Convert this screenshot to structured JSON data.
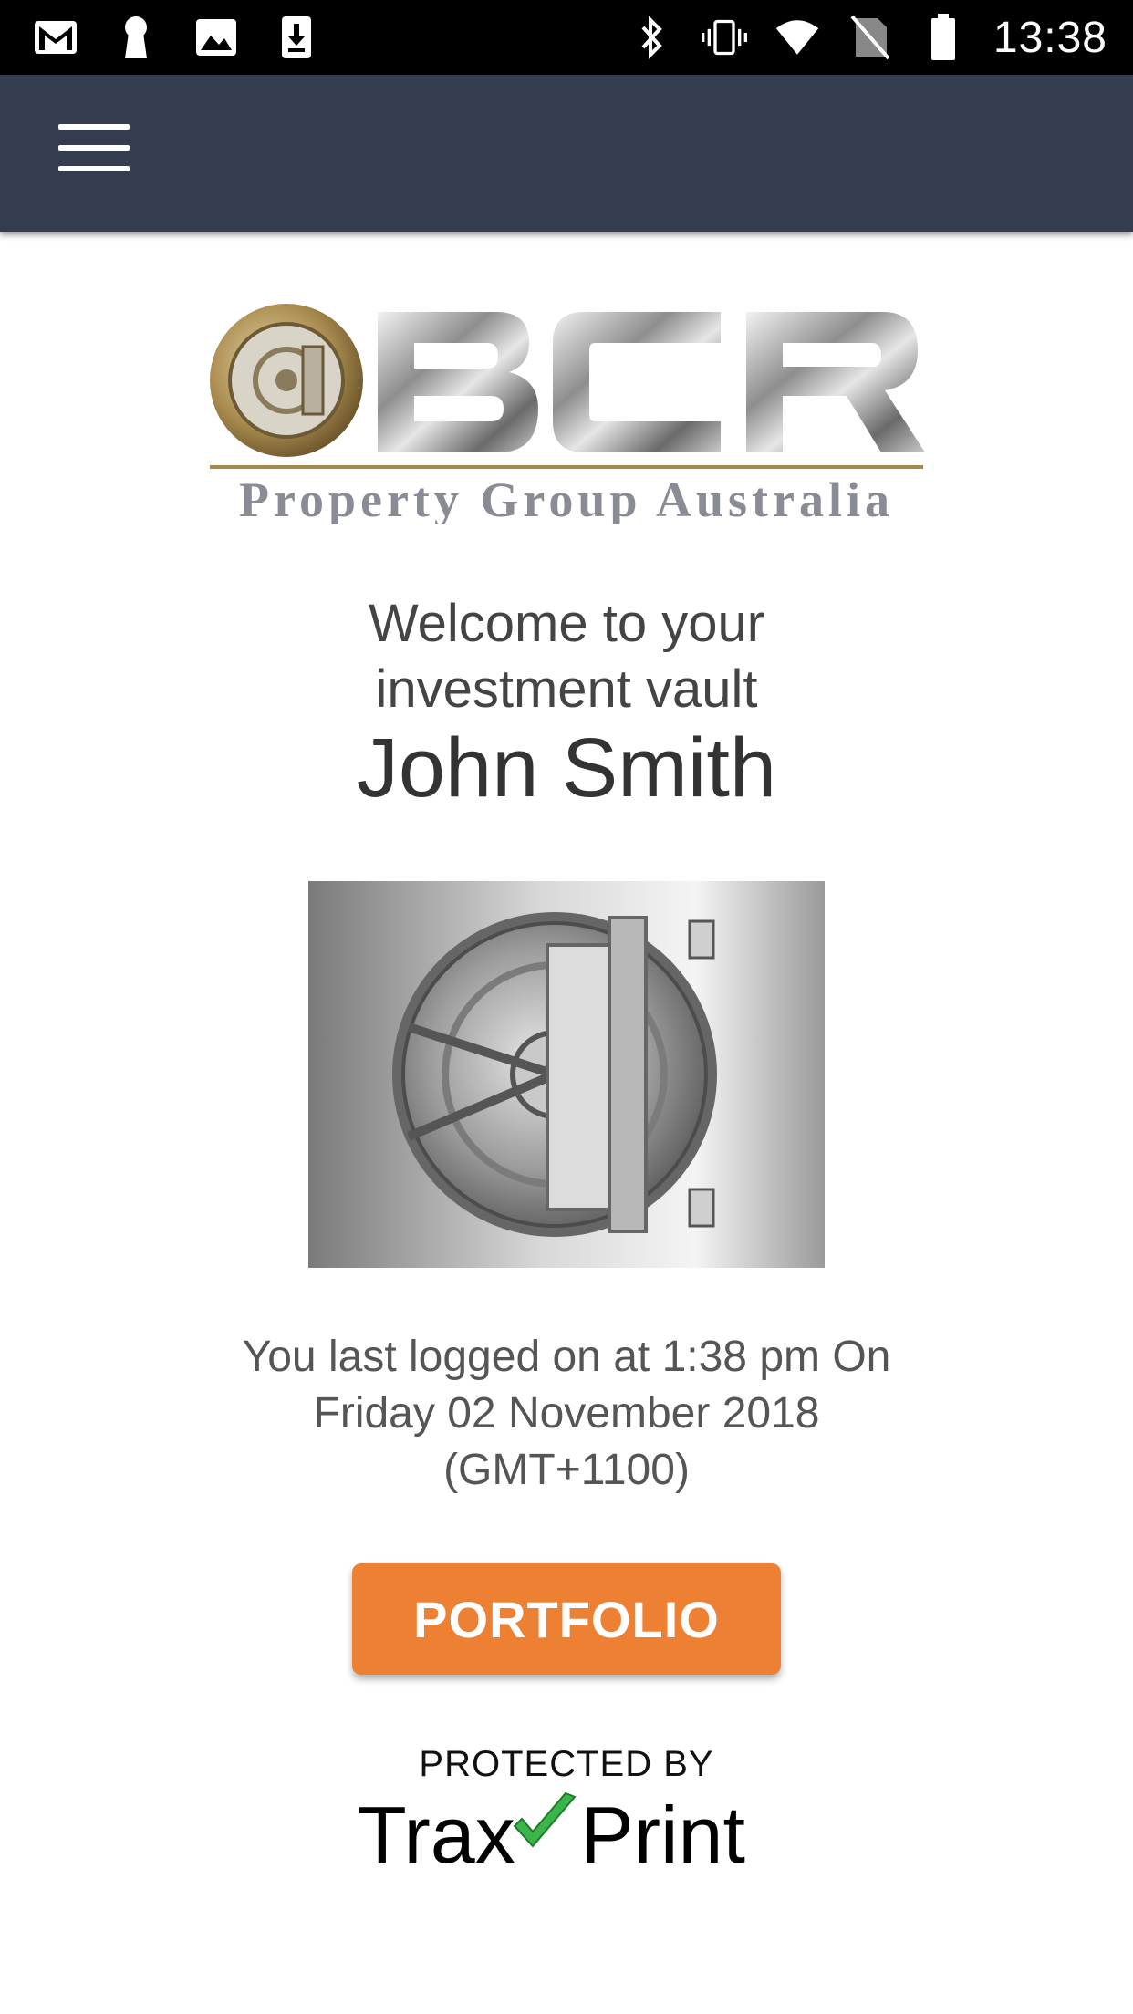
{
  "status_bar": {
    "time": "13:38",
    "left_icons": [
      "gmail-icon",
      "keyhole-icon",
      "image-icon",
      "download-icon"
    ],
    "right_icons": [
      "bluetooth-icon",
      "vibrate-icon",
      "wifi-icon",
      "no-sim-icon",
      "battery-icon"
    ]
  },
  "app_bar": {
    "background": "#343d50",
    "menu_icon": "hamburger-menu-icon"
  },
  "logo": {
    "brand": "BCR",
    "subtitle": "Property Group Australia"
  },
  "welcome": {
    "line1": "Welcome to your",
    "line2": "investment vault",
    "user_name": "John Smith"
  },
  "vault_image": {
    "icon": "vault-door-icon"
  },
  "last_login": {
    "line1": "You last logged on at 1:38 pm On",
    "line2": "Friday 02 November 2018",
    "line3": "(GMT+1100)"
  },
  "portfolio_button": {
    "label": "PORTFOLIO",
    "color": "#ee8033"
  },
  "traxprint": {
    "protected_by": "PROTECTED BY",
    "brand_left": "Trax",
    "brand_right": "Print"
  }
}
